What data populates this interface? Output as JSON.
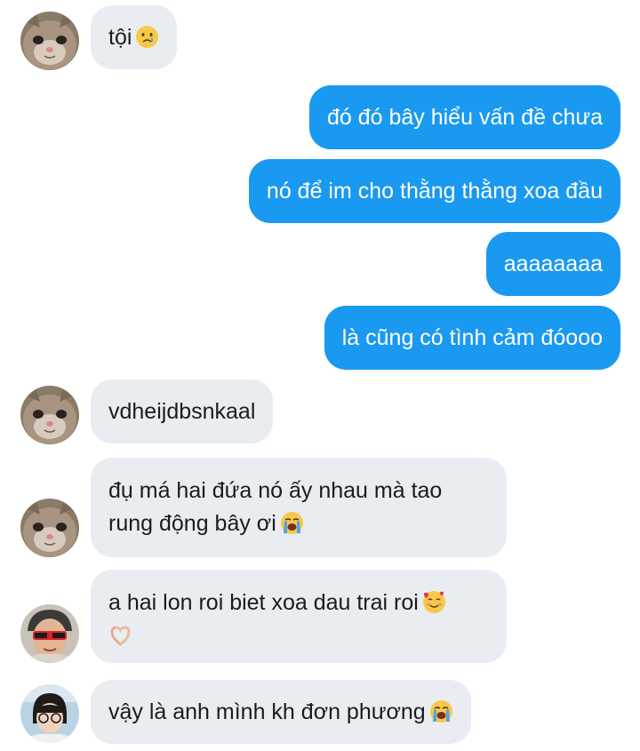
{
  "messages": [
    {
      "id": "m1",
      "side": "in",
      "text": "tội",
      "emoji": "crying-face-emoji"
    },
    {
      "id": "m2",
      "side": "out",
      "text": "đó đó bây hiểu vấn đề chưa"
    },
    {
      "id": "m3",
      "side": "out",
      "text": "nó để im cho thằng thằng xoa đầu"
    },
    {
      "id": "m4",
      "side": "out",
      "text": "aaaaaaaa"
    },
    {
      "id": "m5",
      "side": "out",
      "text": "là cũng có tình cảm đóooo"
    },
    {
      "id": "m6",
      "side": "in",
      "text": "vdheijdbsnkaal"
    },
    {
      "id": "m7",
      "side": "in",
      "line1": "đụ má hai đứa nó ấy nhau mà tao",
      "line2": "rung động bây ơi",
      "emoji": "loudly-crying-face-emoji"
    },
    {
      "id": "m8",
      "side": "in",
      "line1": "a hai lon roi biet xoa dau trai roi",
      "emoji1": "smiling-face-with-hearts-emoji",
      "emoji2": "heart-hands-emoji"
    },
    {
      "id": "m9",
      "side": "in",
      "text": "vậy là anh mình kh đơn phương",
      "emoji": "loudly-crying-face-emoji"
    }
  ],
  "avatars": [
    {
      "id": "cat-avatar",
      "icon": "cat-avatar-icon"
    },
    {
      "id": "sunglasses-avatar",
      "icon": "person-sunglasses-avatar-icon"
    },
    {
      "id": "glasses-avatar",
      "icon": "person-glasses-avatar-icon"
    }
  ],
  "colors": {
    "incoming_bubble": "#e9edf1",
    "outgoing_bubble": "#1a99f1",
    "incoming_text": "#1a1c1f",
    "outgoing_text": "#ffffff"
  }
}
